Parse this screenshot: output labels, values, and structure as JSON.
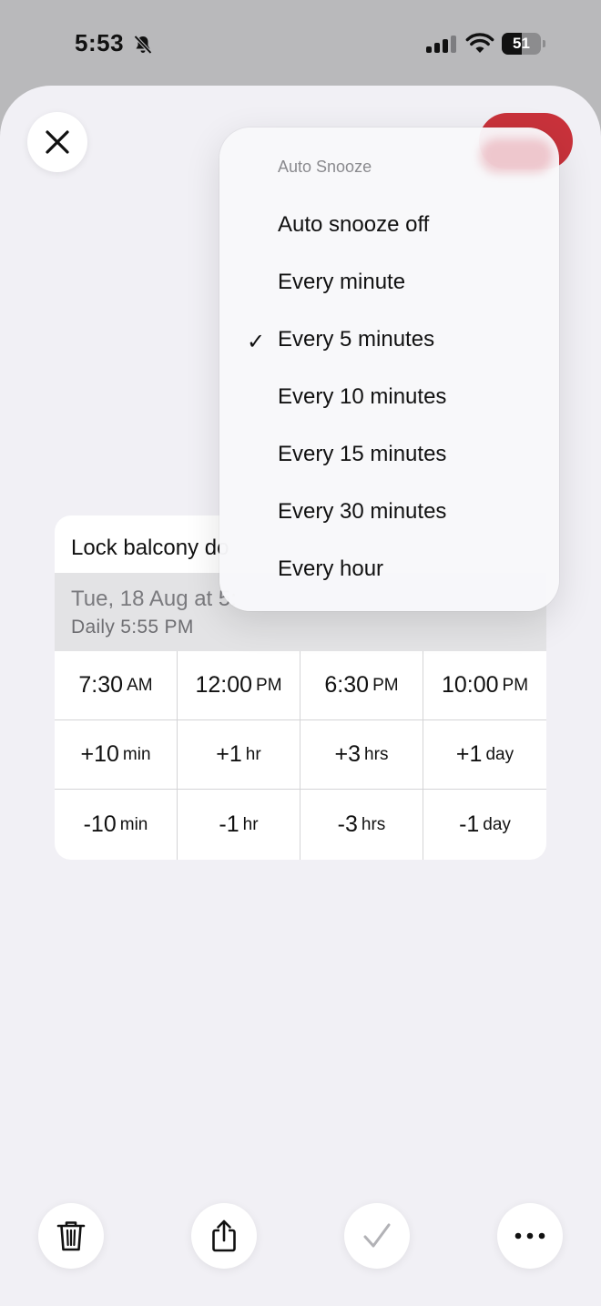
{
  "status_bar": {
    "time": "5:53",
    "battery_level": "51",
    "battery_fraction": 0.51
  },
  "icons": {
    "close": "close-icon",
    "bell": "bell-slash-icon",
    "signal": "cellular-signal-icon",
    "wifi": "wifi-icon",
    "trash": "trash-icon",
    "share": "share-icon",
    "check": "checkmark-icon",
    "more": "more-icon"
  },
  "colors": {
    "accent": "#c9323b",
    "sheet_background": "#f1f0f5",
    "date_strip": "#e3e3e5"
  },
  "reminder": {
    "title": "Lock balcony do",
    "date": "Tue, 18 Aug at 5:",
    "repeat": "Daily 5:55 PM"
  },
  "quick_times": [
    {
      "num": "7:30",
      "unit": "AM"
    },
    {
      "num": "12:00",
      "unit": "PM"
    },
    {
      "num": "6:30",
      "unit": "PM"
    },
    {
      "num": "10:00",
      "unit": "PM"
    }
  ],
  "increase": [
    {
      "num": "+10",
      "unit": "min"
    },
    {
      "num": "+1",
      "unit": "hr"
    },
    {
      "num": "+3",
      "unit": "hrs"
    },
    {
      "num": "+1",
      "unit": "day"
    }
  ],
  "decrease": [
    {
      "num": "-10",
      "unit": "min"
    },
    {
      "num": "-1",
      "unit": "hr"
    },
    {
      "num": "-3",
      "unit": "hrs"
    },
    {
      "num": "-1",
      "unit": "day"
    }
  ],
  "auto_snooze_menu": {
    "title": "Auto Snooze",
    "checkmark": "✓",
    "selected_index": 2,
    "items": [
      "Auto snooze off",
      "Every minute",
      "Every 5 minutes",
      "Every 10 minutes",
      "Every 15 minutes",
      "Every 30 minutes",
      "Every hour"
    ]
  }
}
